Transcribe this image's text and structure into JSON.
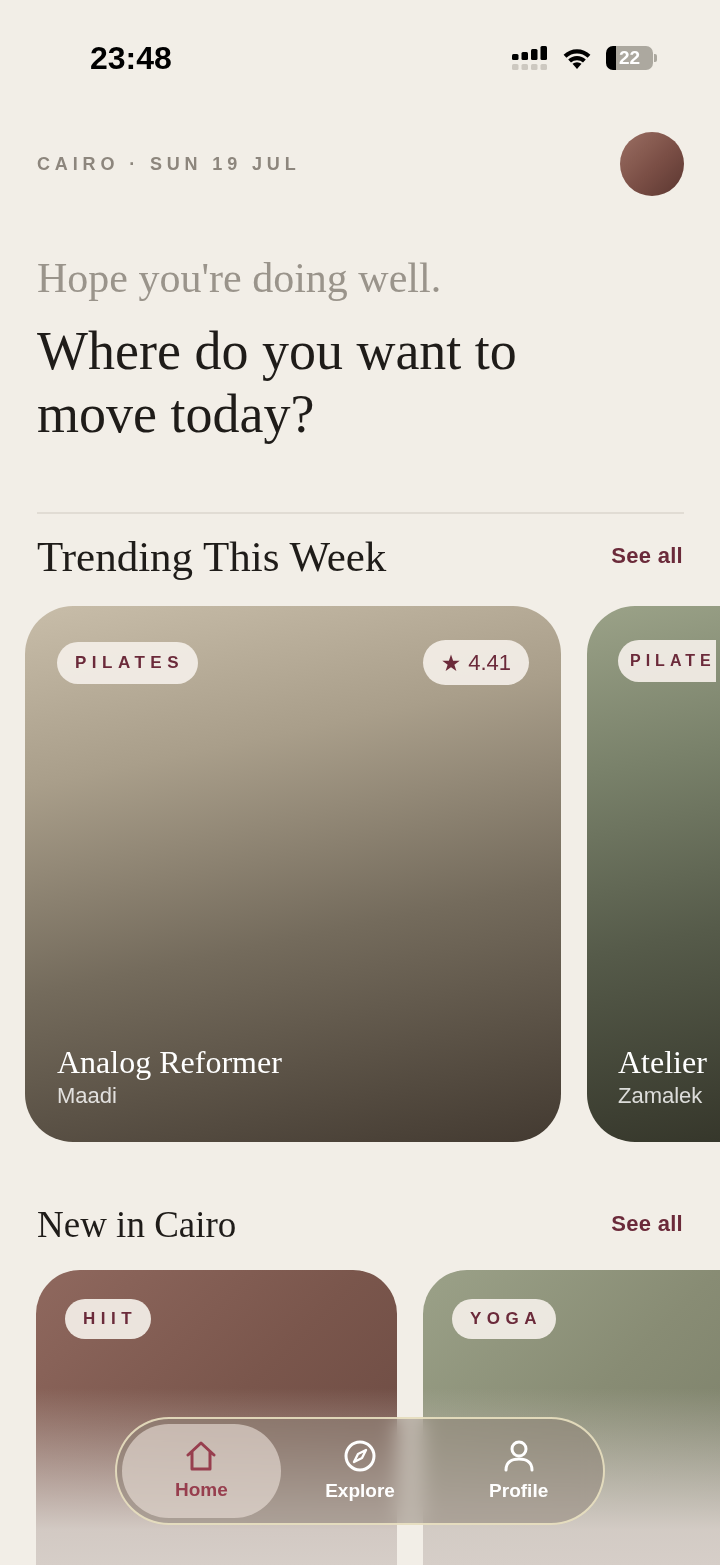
{
  "status_bar": {
    "time": "23:48",
    "battery": "22"
  },
  "header": {
    "location_date": "CAIRO · SUN 19 JUL"
  },
  "intro": {
    "greeting": "Hope you're doing well.",
    "headline": "Where do you want to move today?"
  },
  "sections": [
    {
      "kind": "featured",
      "title": "Trending This Week",
      "action": "See all",
      "cards": [
        {
          "category": "PILATES",
          "rating": "4.41",
          "title": "Analog Reformer",
          "location": "Maadi"
        },
        {
          "category": "PILATE",
          "title": "Atelier",
          "location": "Zamalek"
        }
      ]
    },
    {
      "kind": "compact",
      "title": "New in Cairo",
      "action": "See all",
      "cards": [
        {
          "category": "HIIT"
        },
        {
          "category": "YOGA"
        }
      ]
    }
  ],
  "nav": {
    "tabs": [
      {
        "label": "Home",
        "selected": true
      },
      {
        "label": "Explore",
        "selected": false
      },
      {
        "label": "Profile",
        "selected": false
      }
    ]
  }
}
